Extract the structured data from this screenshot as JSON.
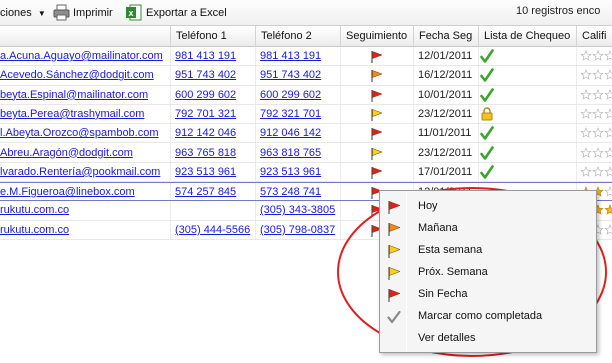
{
  "toolbar": {
    "acciones_label": "ciones",
    "imprimir_label": "Imprimir",
    "exportar_label": "Exportar a Excel",
    "registros_text": "10 registros enco"
  },
  "columns": [
    "Teléfono 1",
    "Teléfono 2",
    "Seguimiento",
    "Fecha Seg",
    "Lista de Chequeo",
    "Califi"
  ],
  "rows": [
    {
      "email": "a.Acuna.Aguayo@mailinator.com",
      "tel1": "981 413 191",
      "tel2": "981 413 191",
      "flag": "red",
      "fecha": "12/01/2011",
      "check": "check",
      "stars": 0
    },
    {
      "email": "Acevedo.Sánchez@dodgit.com",
      "tel1": "951 743 402",
      "tel2": "951 743 402",
      "flag": "orange",
      "fecha": "16/12/2011",
      "check": "check",
      "stars": 0
    },
    {
      "email": "beyta.Espinal@mailinator.com",
      "tel1": "600 299 602",
      "tel2": "600 299 602",
      "flag": "red",
      "fecha": "10/01/2011",
      "check": "check",
      "stars": 0
    },
    {
      "email": "beyta.Perea@trashymail.com",
      "tel1": "792 701 321",
      "tel2": "792 321 701",
      "flag": "yellow",
      "fecha": "23/12/2011",
      "check": "lock",
      "stars": 0
    },
    {
      "email": "l.Abeyta.Orozco@spambob.com",
      "tel1": "912 142 046",
      "tel2": "912 046 142",
      "flag": "red",
      "fecha": "11/01/2011",
      "check": "check",
      "stars": 0
    },
    {
      "email": "Abreu.Aragón@dodgit.com",
      "tel1": "963 765 818",
      "tel2": "963 818 765",
      "flag": "yellow",
      "fecha": "23/12/2011",
      "check": "check",
      "stars": 0
    },
    {
      "email": "lvarado.Rentería@pookmail.com",
      "tel1": "923 513 961",
      "tel2": "923 513 961",
      "flag": "red",
      "fecha": "17/01/2011",
      "check": "check",
      "stars": 0
    },
    {
      "email": "e.M.Figueroa@linebox.com",
      "tel1": "574 257 845",
      "tel2": "573 248 741",
      "flag": "red",
      "fecha": "12/01/2011",
      "check": "",
      "stars": 2
    },
    {
      "email": "rukutu.com.co",
      "tel1": "",
      "tel2": "(305) 343-3805",
      "flag": "red",
      "fecha": "",
      "check": "",
      "stars": 3
    },
    {
      "email": "rukutu.com.co",
      "tel1": "(305) 444-5566",
      "tel2": "(305) 798-0837",
      "flag": "red",
      "fecha": "",
      "check": "",
      "stars": 0
    }
  ],
  "context_menu": [
    {
      "label": "Hoy",
      "icon": "red-flag-icon",
      "color": "#e02020"
    },
    {
      "label": "Mañana",
      "icon": "orange-flag-icon",
      "color": "#f08a1c"
    },
    {
      "label": "Esta semana",
      "icon": "yellow-flag-icon",
      "color": "#f5d21a"
    },
    {
      "label": "Próx. Semana",
      "icon": "yellow-flag-icon",
      "color": "#f5d21a"
    },
    {
      "label": "Sin Fecha",
      "icon": "red-flag-icon",
      "color": "#e02020"
    },
    {
      "label": "Marcar como completada",
      "icon": "checkmark-icon",
      "color": "#8a8a8a"
    },
    {
      "label": "Ver detalles",
      "icon": "",
      "color": ""
    }
  ],
  "colors": {
    "link": "#1a1ad8",
    "flag_red": "#e02020",
    "flag_orange": "#f08a1c",
    "flag_yellow": "#f5d21a",
    "check_green": "#3aa52c",
    "annotation": "#e02020",
    "star_gold": "#f2b51c"
  }
}
